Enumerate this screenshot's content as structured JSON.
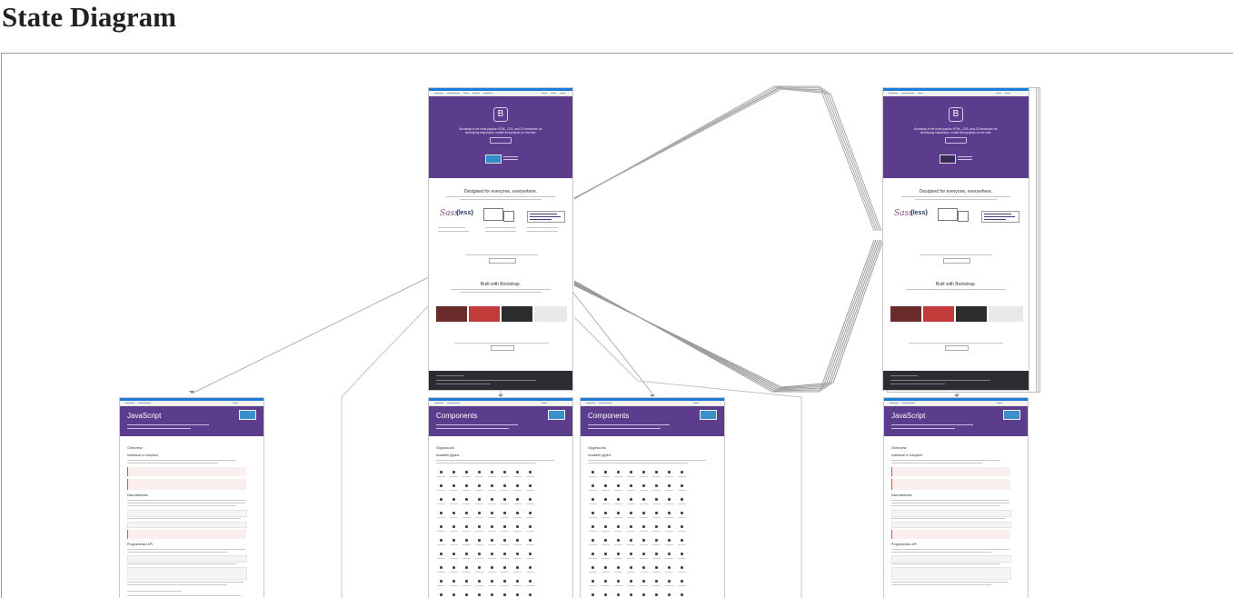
{
  "page": {
    "title": "State Diagram"
  },
  "states": {
    "home": {
      "banner": "",
      "logo_letter": "B",
      "tagline_1": "Bootstrap is the most popular HTML, CSS, and JS framework for",
      "tagline_2": "developing responsive, mobile first projects on the web.",
      "section_1_title": "Designed for everyone, everywhere.",
      "section_2_title": "Built with Bootstrap.",
      "sass_logo": "Sass",
      "less_logo": "{less}"
    },
    "js_docs": {
      "title": "JavaScript"
    },
    "components_1": {
      "title": "Components",
      "subtitle": "Glyphicons"
    },
    "components_2": {
      "title": "Components",
      "subtitle": "Glyphicons"
    },
    "home_repeat": {
      "logo_letter": "B"
    },
    "js_docs_repeat": {
      "title": "JavaScript"
    }
  },
  "colors": {
    "hero_purple": "#5b3c8d",
    "topbar_blue": "#1d7bd8",
    "edge_gray": "#9a9a9a",
    "footer_dark": "#2c2c33"
  }
}
